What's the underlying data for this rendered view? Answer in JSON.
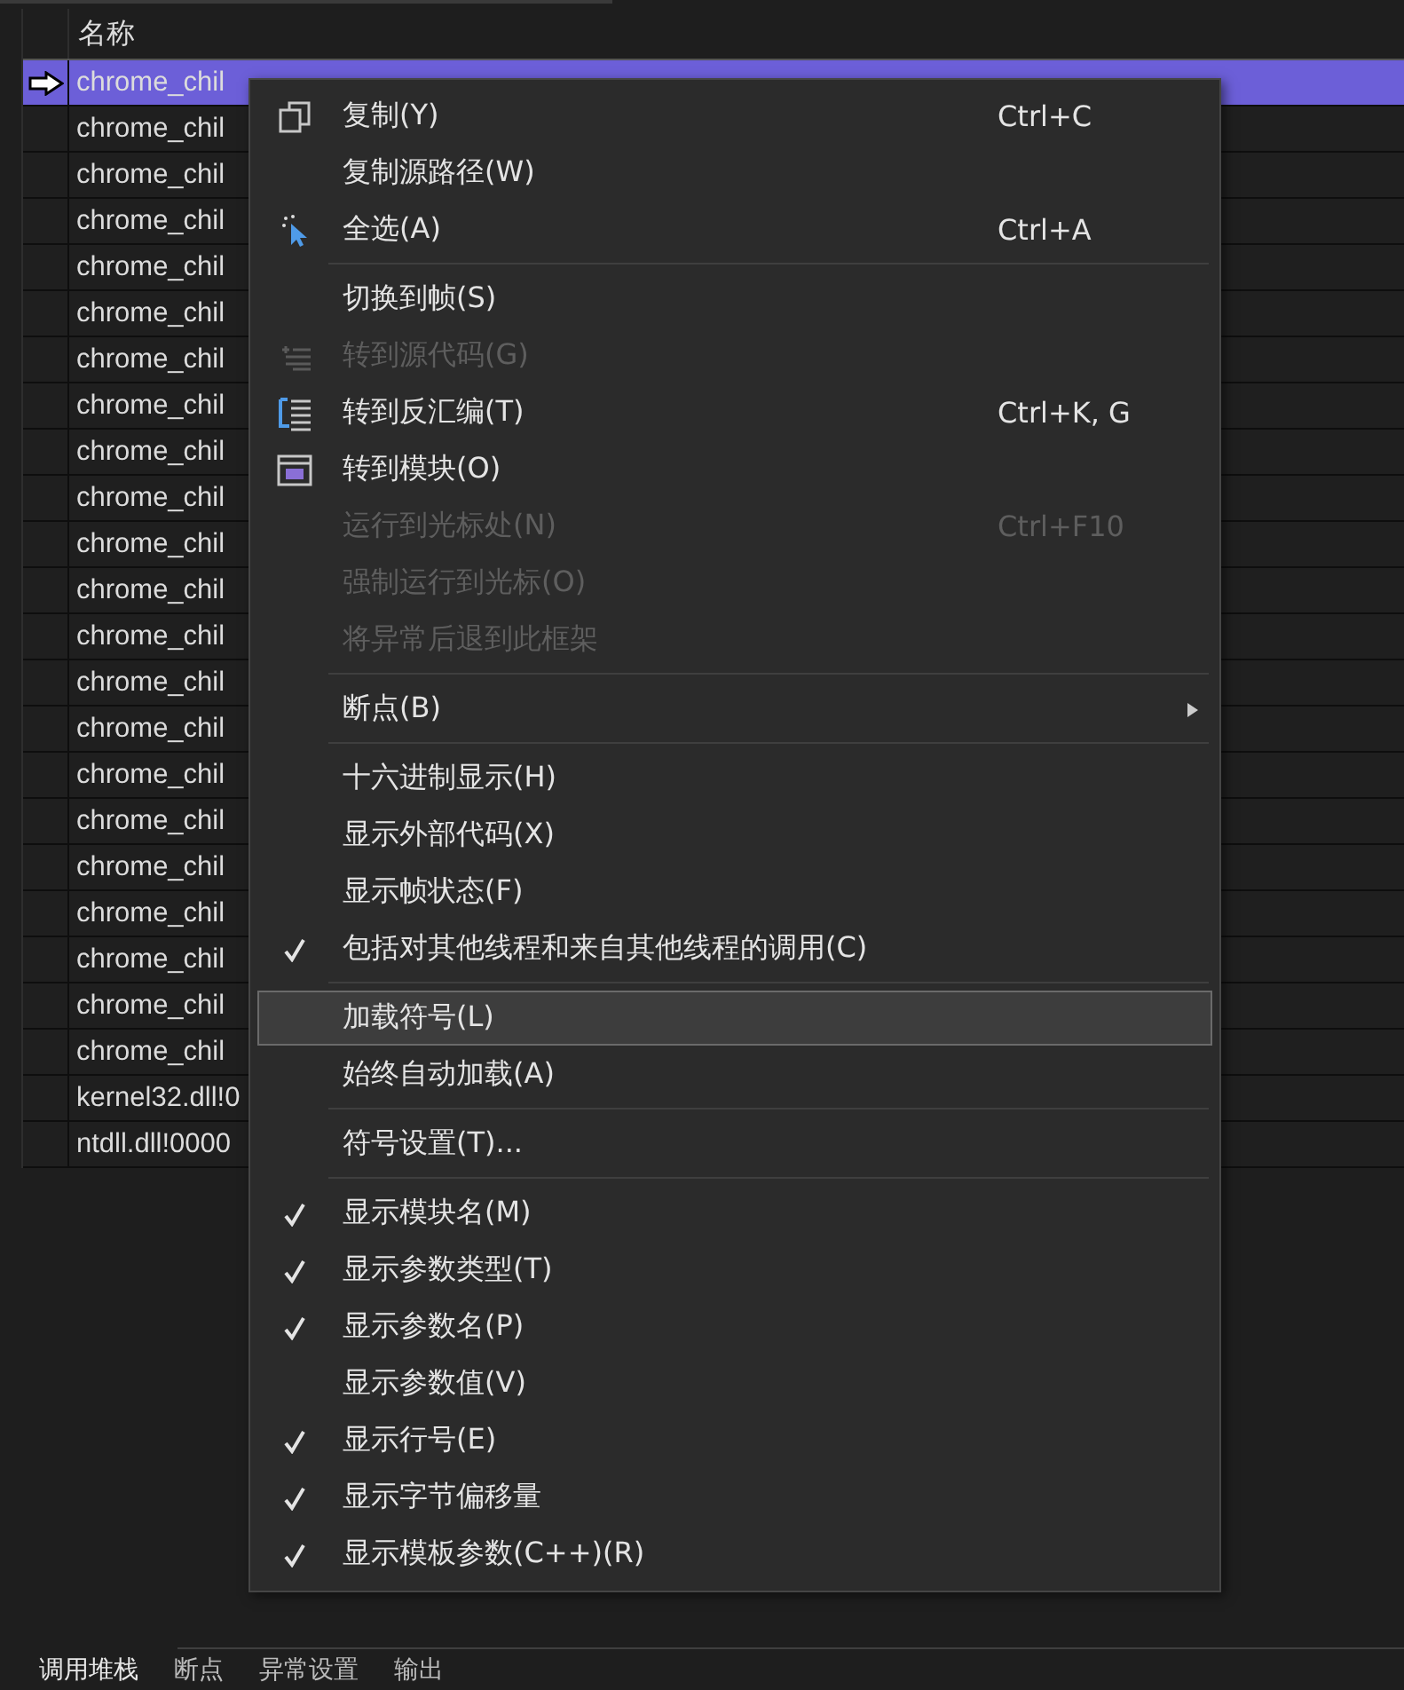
{
  "grid": {
    "columns": [
      {
        "label": "名称"
      }
    ],
    "rows": [
      {
        "name": "chrome_chil",
        "current": true,
        "selected": true
      },
      {
        "name": "chrome_chil",
        "current": false,
        "selected": false
      },
      {
        "name": "chrome_chil",
        "current": false,
        "selected": false
      },
      {
        "name": "chrome_chil",
        "current": false,
        "selected": false
      },
      {
        "name": "chrome_chil",
        "current": false,
        "selected": false
      },
      {
        "name": "chrome_chil",
        "current": false,
        "selected": false
      },
      {
        "name": "chrome_chil",
        "current": false,
        "selected": false
      },
      {
        "name": "chrome_chil",
        "current": false,
        "selected": false
      },
      {
        "name": "chrome_chil",
        "current": false,
        "selected": false
      },
      {
        "name": "chrome_chil",
        "current": false,
        "selected": false
      },
      {
        "name": "chrome_chil",
        "current": false,
        "selected": false
      },
      {
        "name": "chrome_chil",
        "current": false,
        "selected": false
      },
      {
        "name": "chrome_chil",
        "current": false,
        "selected": false
      },
      {
        "name": "chrome_chil",
        "current": false,
        "selected": false
      },
      {
        "name": "chrome_chil",
        "current": false,
        "selected": false
      },
      {
        "name": "chrome_chil",
        "current": false,
        "selected": false
      },
      {
        "name": "chrome_chil",
        "current": false,
        "selected": false
      },
      {
        "name": "chrome_chil",
        "current": false,
        "selected": false
      },
      {
        "name": "chrome_chil",
        "current": false,
        "selected": false
      },
      {
        "name": "chrome_chil",
        "current": false,
        "selected": false
      },
      {
        "name": "chrome_chil",
        "current": false,
        "selected": false
      },
      {
        "name": "chrome_chil",
        "current": false,
        "selected": false
      },
      {
        "name": "kernel32.dll!0",
        "current": false,
        "selected": false
      },
      {
        "name": "ntdll.dll!0000",
        "current": false,
        "selected": false
      }
    ]
  },
  "context_menu": {
    "items": [
      {
        "kind": "item",
        "label": "复制(Y)",
        "shortcut": "Ctrl+C",
        "disabled": false,
        "checked": false,
        "selected": false
      },
      {
        "kind": "item",
        "label": "复制源路径(W)",
        "disabled": false,
        "checked": false,
        "selected": false
      },
      {
        "kind": "item",
        "label": "全选(A)",
        "shortcut": "Ctrl+A",
        "disabled": false,
        "checked": false,
        "selected": false
      },
      {
        "kind": "separator"
      },
      {
        "kind": "item",
        "label": "切换到帧(S)",
        "disabled": false,
        "checked": false,
        "selected": false
      },
      {
        "kind": "item",
        "label": "转到源代码(G)",
        "disabled": true,
        "checked": false,
        "selected": false
      },
      {
        "kind": "item",
        "label": "转到反汇编(T)",
        "shortcut": "Ctrl+K, G",
        "disabled": false,
        "checked": false,
        "selected": false
      },
      {
        "kind": "item",
        "label": "转到模块(O)",
        "disabled": false,
        "checked": false,
        "selected": false
      },
      {
        "kind": "item",
        "label": "运行到光标处(N)",
        "shortcut": "Ctrl+F10",
        "disabled": true,
        "checked": false,
        "selected": false
      },
      {
        "kind": "item",
        "label": "强制运行到光标(O)",
        "disabled": true,
        "checked": false,
        "selected": false
      },
      {
        "kind": "item",
        "label": "将异常后退到此框架",
        "disabled": true,
        "checked": false,
        "selected": false
      },
      {
        "kind": "separator"
      },
      {
        "kind": "submenu",
        "label": "断点(B)",
        "disabled": false,
        "checked": false,
        "selected": false
      },
      {
        "kind": "separator"
      },
      {
        "kind": "item",
        "label": "十六进制显示(H)",
        "disabled": false,
        "checked": false,
        "selected": false
      },
      {
        "kind": "item",
        "label": "显示外部代码(X)",
        "disabled": false,
        "checked": false,
        "selected": false
      },
      {
        "kind": "item",
        "label": "显示帧状态(F)",
        "disabled": false,
        "checked": false,
        "selected": false
      },
      {
        "kind": "item",
        "label": "包括对其他线程和来自其他线程的调用(C)",
        "disabled": false,
        "checked": true,
        "selected": false
      },
      {
        "kind": "separator"
      },
      {
        "kind": "item",
        "label": "加载符号(L)",
        "disabled": false,
        "checked": false,
        "selected": true
      },
      {
        "kind": "item",
        "label": "始终自动加载(A)",
        "disabled": false,
        "checked": false,
        "selected": false
      },
      {
        "kind": "separator"
      },
      {
        "kind": "item",
        "label": "符号设置(T)...",
        "disabled": false,
        "checked": false,
        "selected": false
      },
      {
        "kind": "separator"
      },
      {
        "kind": "item",
        "label": "显示模块名(M)",
        "disabled": false,
        "checked": true,
        "selected": false
      },
      {
        "kind": "item",
        "label": "显示参数类型(T)",
        "disabled": false,
        "checked": true,
        "selected": false
      },
      {
        "kind": "item",
        "label": "显示参数名(P)",
        "disabled": false,
        "checked": true,
        "selected": false
      },
      {
        "kind": "item",
        "label": "显示参数值(V)",
        "disabled": false,
        "checked": false,
        "selected": false
      },
      {
        "kind": "item",
        "label": "显示行号(E)",
        "disabled": false,
        "checked": true,
        "selected": false
      },
      {
        "kind": "item",
        "label": "显示字节偏移量",
        "disabled": false,
        "checked": true,
        "selected": false
      },
      {
        "kind": "item",
        "label": "显示模板参数(C++)(R)",
        "disabled": false,
        "checked": true,
        "selected": false
      }
    ]
  },
  "bottom_tabs": [
    {
      "label": "调用堆栈",
      "selected": true
    },
    {
      "label": "断点",
      "selected": false
    },
    {
      "label": "异常设置",
      "selected": false
    },
    {
      "label": "输出",
      "selected": false
    }
  ]
}
